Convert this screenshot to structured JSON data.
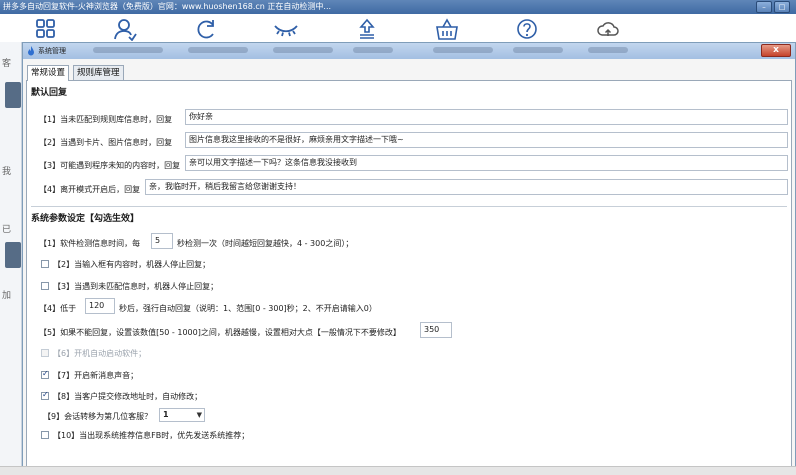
{
  "app": {
    "title": "拼多多自动回复软件-火神浏览器（免费版）官网：www.huoshen168.cn  正在自动检测中..."
  },
  "window_controls": {
    "minimize": "–",
    "restore": "□"
  },
  "toolbar": {
    "icons": [
      "grid-icon",
      "user-icon",
      "refresh-icon",
      "eye-closed-icon",
      "upload-icon",
      "basket-icon",
      "help-icon",
      "cloud-icon"
    ]
  },
  "background": {
    "left_texts": [
      "客",
      "我",
      "已",
      "加"
    ]
  },
  "dialog": {
    "title": "系统管理",
    "close_label": "x",
    "tabs": [
      "常规设置",
      "规则库管理"
    ],
    "default_reply": {
      "title": "默认回复",
      "rows": [
        {
          "label": "【1】当未匹配到规则库信息时，回复",
          "value": "你好亲"
        },
        {
          "label": "【2】当遇到卡片、图片信息时，回复",
          "value": "图片信息我这里接收的不是很好，麻烦亲用文字描述一下哦~"
        },
        {
          "label": "【3】可能遇到程序未知的内容时，回复",
          "value": "亲可以用文字描述一下吗？这条信息我没接收到"
        },
        {
          "label": "【4】离开模式开启后，回复",
          "value": "亲，我临时开，稍后我留言给您谢谢支持！"
        }
      ]
    },
    "system_params": {
      "title": "系统参数设定【勾选生效】",
      "p1": {
        "prefix": "【1】软件检测信息时间，每",
        "value": "5",
        "suffix": "秒检测一次（时间越短回复越快，4 - 300之间）；"
      },
      "p2": {
        "label": "【2】当输入框有内容时，机器人停止回复；",
        "checked": false
      },
      "p3": {
        "label": "【3】当遇到未匹配信息时，机器人停止回复；",
        "checked": false
      },
      "p4": {
        "prefix": "【4】低于",
        "value": "120",
        "suffix": "秒后，强行自动回复（说明：1、范围[0 - 300]秒；2、不开启请输入0）"
      },
      "p5": {
        "label": "【5】如果不能回复，设置该数值[50 - 1000]之间，机器越慢，设置相对大点【一般情况下不要修改】",
        "value": "350"
      },
      "p6": {
        "label": "【6】开机自动启动软件；",
        "checked": false,
        "disabled": true
      },
      "p7": {
        "label": "【7】开启新消息声音；",
        "checked": true
      },
      "p8": {
        "label": "【8】当客户提交修改地址时，自动修改；",
        "checked": true
      },
      "p9": {
        "label": "【9】会话转移为第几位客服？",
        "value": "1"
      },
      "p10": {
        "label": "【10】当出现系统推荐信息FB时，优先发送系统推荐；",
        "checked": false
      }
    }
  }
}
